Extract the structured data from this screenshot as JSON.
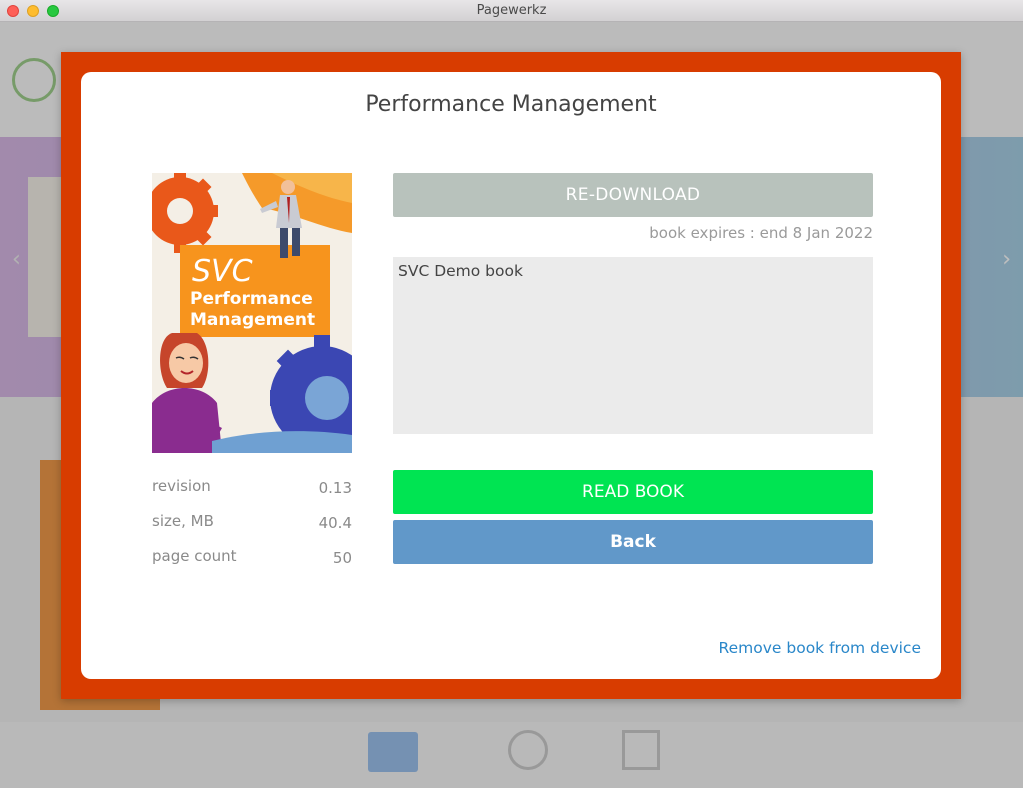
{
  "window": {
    "title": "Pagewerkz"
  },
  "modal": {
    "title": "Performance Management",
    "redownload_label": "RE-DOWNLOAD",
    "expires_text": "book expires : end 8 Jan 2022",
    "description": "SVC Demo book",
    "read_label": "READ BOOK",
    "back_label": "Back",
    "remove_label": "Remove book from device",
    "meta": [
      {
        "label": "revision",
        "value": "0.13"
      },
      {
        "label": "size, MB",
        "value": "40.4"
      },
      {
        "label": "page count",
        "value": "50"
      }
    ],
    "cover": {
      "brand": "SVC",
      "line1": "Performance",
      "line2": "Management"
    }
  },
  "colors": {
    "frame": "#d83c00",
    "redownload": "#b8c2bc",
    "read": "#00e452",
    "back": "#6198c9",
    "link": "#2a87c9"
  }
}
